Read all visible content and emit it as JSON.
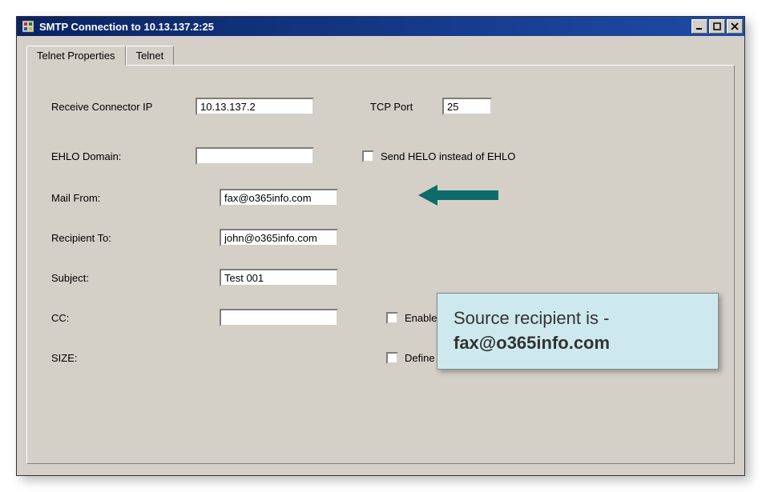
{
  "window": {
    "title": "SMTP Connection to 10.13.137.2:25"
  },
  "tabs": {
    "telnet_properties": "Telnet Properties",
    "telnet": "Telnet"
  },
  "labels": {
    "receive_connector_ip": "Receive Connector IP",
    "tcp_port": "TCP Port",
    "ehlo_domain": "EHLO Domain:",
    "send_helo": "Send HELO instead of EHLO",
    "mail_from": "Mail From:",
    "recipient_to": "Recipient To:",
    "subject": "Subject:",
    "cc": "CC:",
    "enable_cc": "Enable CC",
    "size": "SIZE:",
    "define_size": "Define Message SIZE in KiloBytes"
  },
  "values": {
    "receive_connector_ip": "10.13.137.2",
    "tcp_port": "25",
    "ehlo_domain": "",
    "mail_from": "fax@o365info.com",
    "recipient_to": "john@o365info.com",
    "subject": "Test 001",
    "cc": "",
    "size": ""
  },
  "callout": {
    "line1": "Source recipient is -",
    "line2": "fax@o365info.com"
  }
}
